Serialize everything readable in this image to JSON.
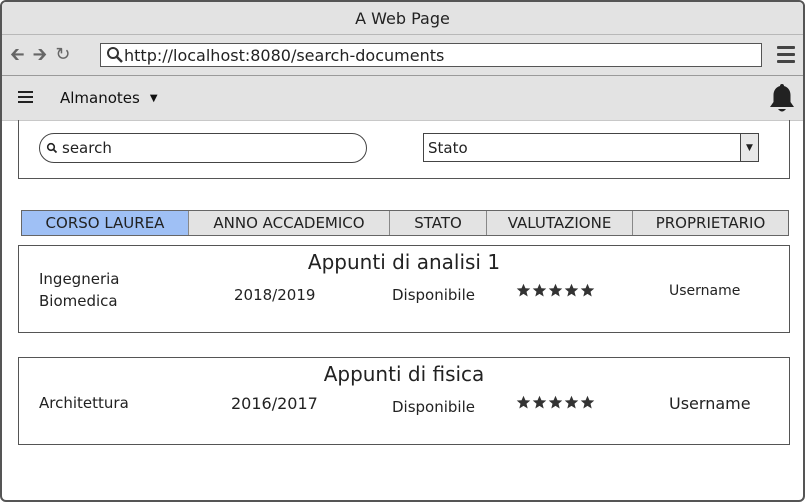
{
  "window": {
    "title": "A Web Page"
  },
  "browser": {
    "url": "http://localhost:8080/search-documents"
  },
  "app": {
    "brand": "Almanotes"
  },
  "filters": {
    "search_placeholder": "search",
    "status_select": "Stato"
  },
  "tabs": [
    {
      "label": "CORSO LAUREA",
      "active": true
    },
    {
      "label": "ANNO ACCADEMICO",
      "active": false
    },
    {
      "label": "STATO",
      "active": false
    },
    {
      "label": "VALUTAZIONE",
      "active": false
    },
    {
      "label": "PROPRIETARIO",
      "active": false
    }
  ],
  "documents": [
    {
      "title": "Appunti di analisi 1",
      "course_line1": "Ingegneria",
      "course_line2": "Biomedica",
      "year": "2018/2019",
      "status": "Disponibile",
      "rating": 5,
      "owner": "Username"
    },
    {
      "title": "Appunti di fisica",
      "course_line1": "Architettura",
      "course_line2": "",
      "year": "2016/2017",
      "status": "Disponibile",
      "rating": 5,
      "owner": "Username"
    }
  ],
  "colors": {
    "active_tab": "#9fc0f5",
    "chrome": "#e3e3e3"
  },
  "icons": [
    "back-arrow-icon",
    "forward-arrow-icon",
    "reload-icon",
    "search-icon",
    "browser-menu-icon",
    "menu-icon",
    "caret-down-icon",
    "bell-icon",
    "star-icon"
  ]
}
